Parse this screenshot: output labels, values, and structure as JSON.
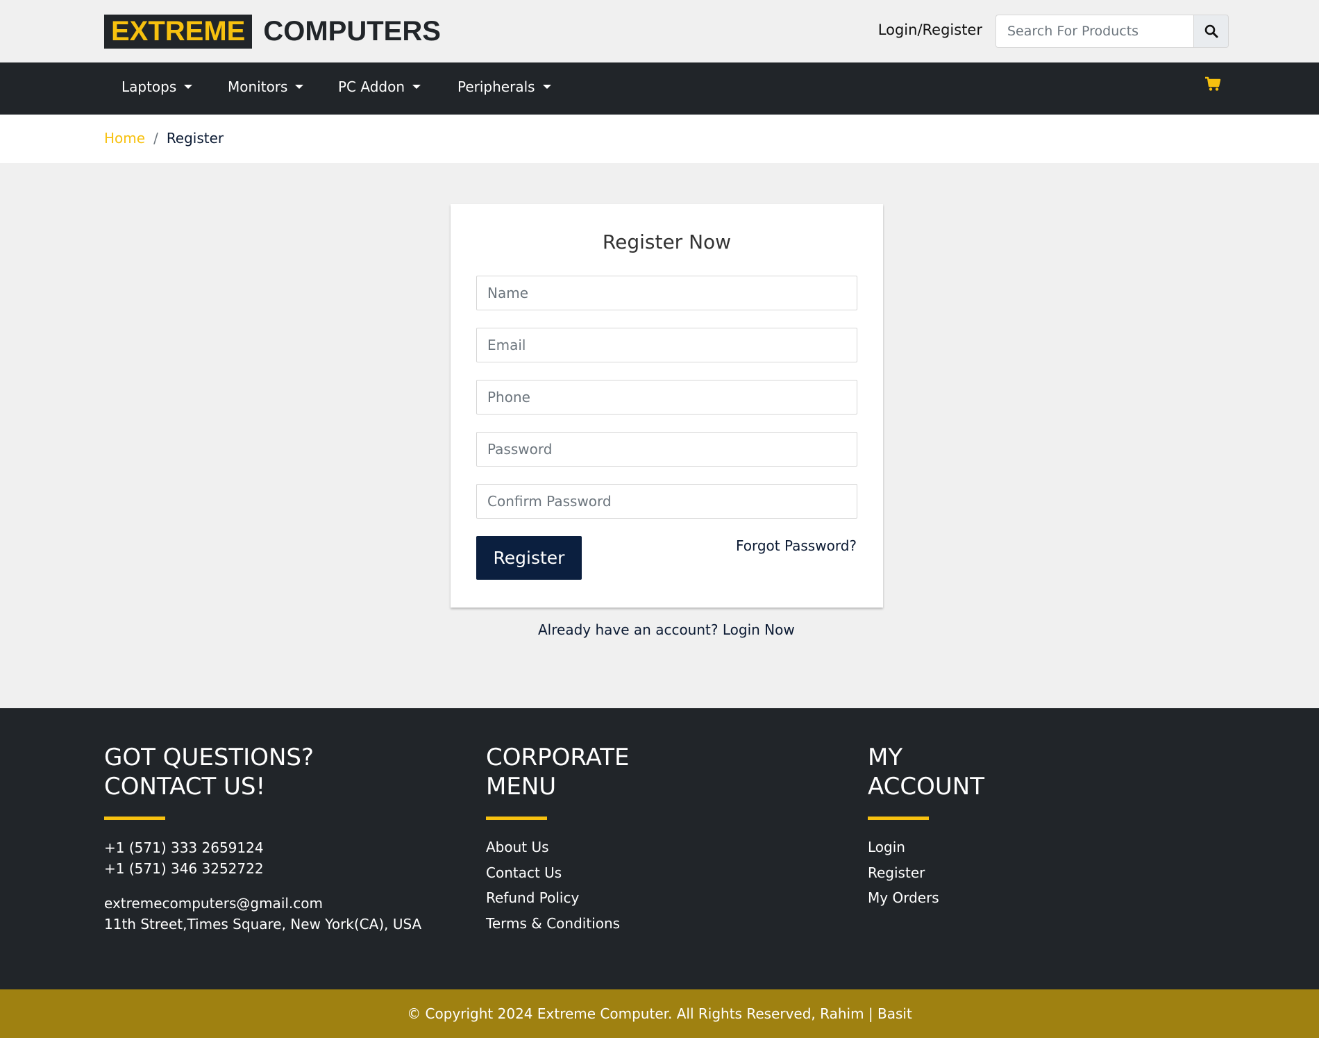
{
  "header": {
    "logo_highlight": "EXTREME",
    "logo_rest": "COMPUTERS",
    "login_register": "Login/Register",
    "search_placeholder": "Search For Products"
  },
  "nav": {
    "items": [
      {
        "label": "Laptops"
      },
      {
        "label": "Monitors"
      },
      {
        "label": "PC Addon"
      },
      {
        "label": "Peripherals"
      }
    ]
  },
  "breadcrumb": {
    "home": "Home",
    "separator": "/",
    "current": "Register"
  },
  "register_form": {
    "title": "Register Now",
    "name_placeholder": "Name",
    "email_placeholder": "Email",
    "phone_placeholder": "Phone",
    "password_placeholder": "Password",
    "confirm_placeholder": "Confirm Password",
    "submit_label": "Register",
    "forgot_label": "Forgot Password?",
    "already_text": "Already have an account?",
    "login_now": "Login Now"
  },
  "footer": {
    "contact": {
      "heading_line1": "GOT QUESTIONS?",
      "heading_line2": "CONTACT US!",
      "phone1": "+1 (571) 333 2659124",
      "phone2": "+1 (571) 346 3252722",
      "email": "extremecomputers@gmail.com",
      "address": "11th Street,Times Square, New York(CA), USA"
    },
    "corporate": {
      "heading_line1": "CORPORATE",
      "heading_line2": "MENU",
      "links": [
        "About Us",
        "Contact Us",
        "Refund Policy",
        "Terms & Conditions"
      ]
    },
    "account": {
      "heading_line1": "MY",
      "heading_line2": "ACCOUNT",
      "links": [
        "Login",
        "Register",
        "My Orders"
      ]
    },
    "copyright": "© Copyright 2024 Extreme Computer. All Rights Reserved, Rahim | Basit"
  },
  "colors": {
    "accent": "#f7c10f",
    "dark": "#212529",
    "navy_button": "#0b1f3f",
    "copyright_bg": "#9f8111"
  },
  "icons": {
    "search": "search-icon",
    "cart": "cart-icon"
  }
}
